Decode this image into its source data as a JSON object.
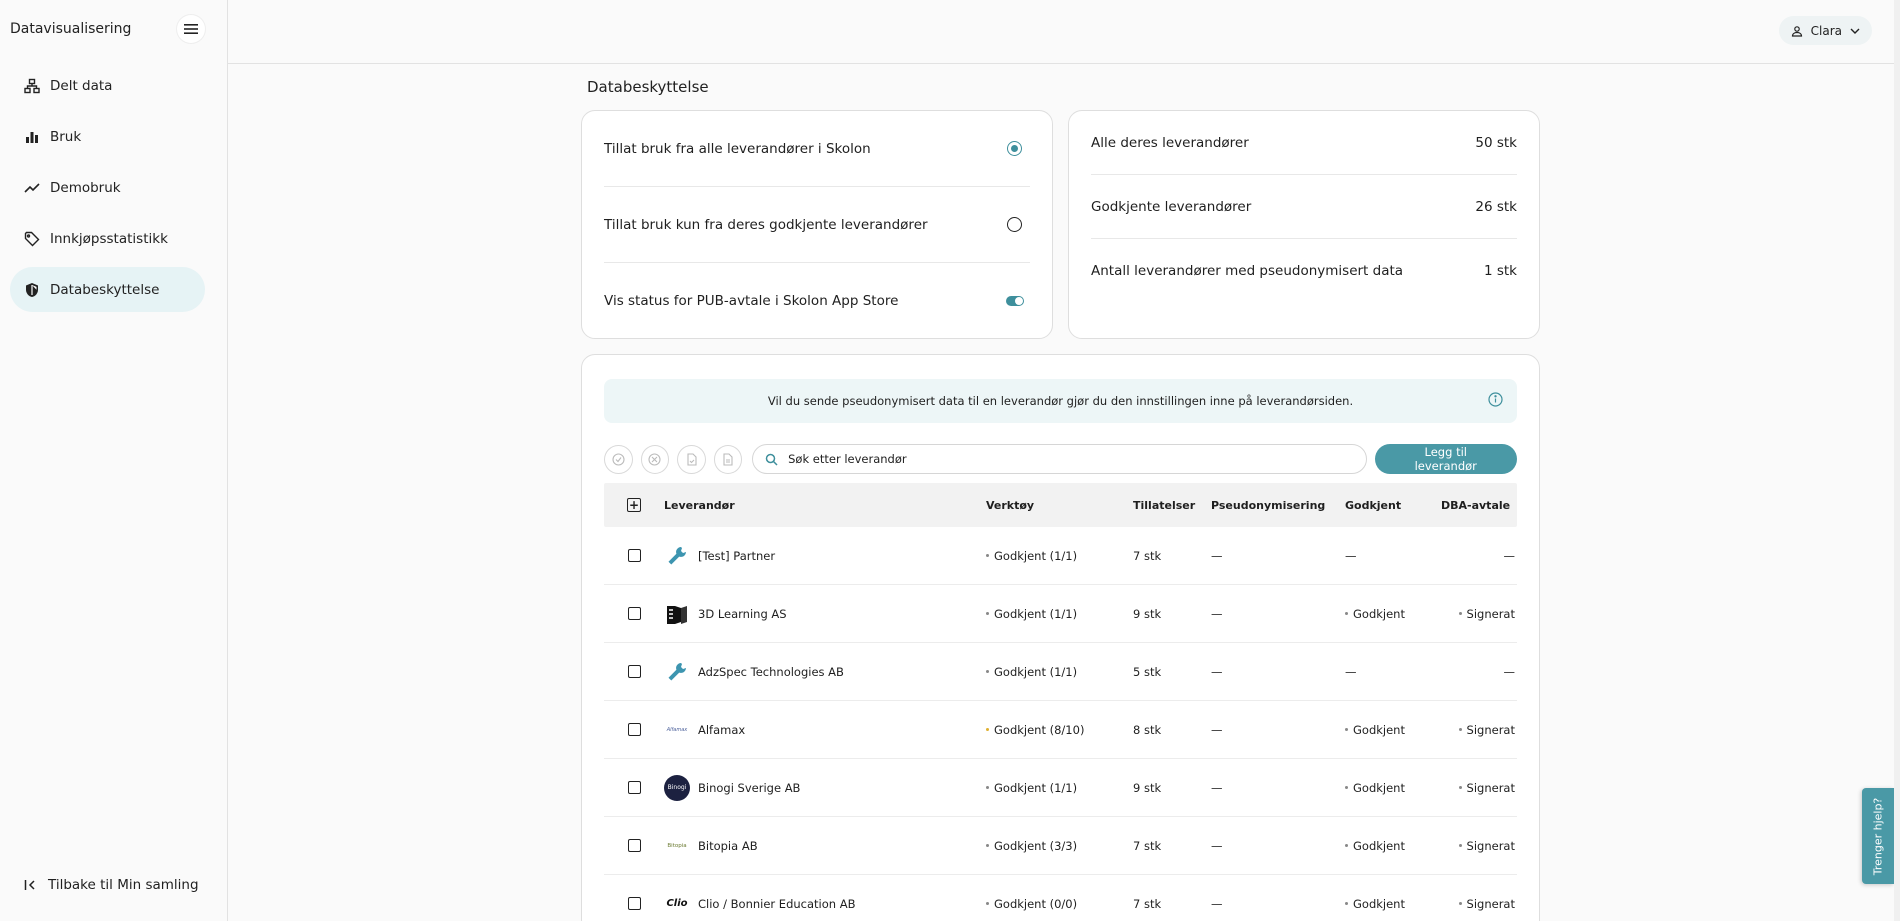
{
  "sidebar": {
    "title": "Datavisualisering",
    "items": [
      {
        "label": "Delt data",
        "icon": "network-icon"
      },
      {
        "label": "Bruk",
        "icon": "bar-chart-icon"
      },
      {
        "label": "Demobruk",
        "icon": "trend-line-icon"
      },
      {
        "label": "Innkjøpsstatistikk",
        "icon": "tag-icon"
      },
      {
        "label": "Databeskyttelse",
        "icon": "shield-icon",
        "active": true
      }
    ],
    "back_label": "Tilbake til Min samling"
  },
  "header": {
    "user_name": "Clara"
  },
  "page": {
    "title": "Databeskyttelse"
  },
  "settings": {
    "allow_all_label": "Tillat bruk fra alle leverandører i Skolon",
    "allow_approved_label": "Tillat bruk kun fra deres godkjente leverandører",
    "show_pub_label": "Vis status for PUB-avtale i Skolon App Store"
  },
  "stats": [
    {
      "label": "Alle deres leverandører",
      "value": "50 stk"
    },
    {
      "label": "Godkjente leverandører",
      "value": "26 stk"
    },
    {
      "label": "Antall leverandører med pseudonymisert data",
      "value": "1 stk"
    }
  ],
  "info_banner": "Vil du sende pseudonymisert data til en leverandør gjør du den innstillingen inne på leverandørsiden.",
  "search": {
    "placeholder": "Søk etter leverandør"
  },
  "add_button": "Legg til leverandør",
  "table": {
    "columns": [
      "Leverandør",
      "Verktøy",
      "Tillatelser",
      "Pseudonymisering",
      "Godkjent",
      "DBA-avtale"
    ],
    "rows": [
      {
        "name": "[Test] Partner",
        "tool": "Godkjent (1/1)",
        "perm": "7 stk",
        "pseudo": "—",
        "approved": "—",
        "dba": "—"
      },
      {
        "name": "3D Learning AS",
        "tool": "Godkjent (1/1)",
        "perm": "9 stk",
        "pseudo": "—",
        "approved": "Godkjent",
        "dba": "Signerat"
      },
      {
        "name": "AdzSpec Technologies AB",
        "tool": "Godkjent (1/1)",
        "perm": "5 stk",
        "pseudo": "—",
        "approved": "—",
        "dba": "—"
      },
      {
        "name": "Alfamax",
        "tool": "Godkjent (8/10)",
        "perm": "8 stk",
        "pseudo": "—",
        "approved": "Godkjent",
        "dba": "Signerat"
      },
      {
        "name": "Binogi Sverige AB",
        "tool": "Godkjent (1/1)",
        "perm": "9 stk",
        "pseudo": "—",
        "approved": "Godkjent",
        "dba": "Signerat"
      },
      {
        "name": "Bitopia AB",
        "tool": "Godkjent (3/3)",
        "perm": "7 stk",
        "pseudo": "—",
        "approved": "Godkjent",
        "dba": "Signerat"
      },
      {
        "name": "Clio / Bonnier Education AB",
        "tool": "Godkjent (0/0)",
        "perm": "7 stk",
        "pseudo": "—",
        "approved": "Godkjent",
        "dba": "Signerat"
      }
    ],
    "logo_texts": {
      "alfamax": "Alfamax",
      "binogi": "Binogi",
      "bitopia": "Bitopia",
      "clio": "Clio"
    }
  },
  "help_tab": "Trenger hjelp?",
  "colors": {
    "accent": "#4a99a6",
    "active_nav": "#e6f3f5"
  }
}
